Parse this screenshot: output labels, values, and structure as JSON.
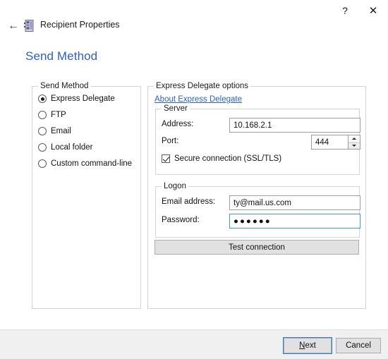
{
  "window": {
    "title": "Recipient Properties",
    "help_label": "?",
    "close_label": "✕",
    "back_label": "←",
    "icon_name": "recipient-properties-icon"
  },
  "page": {
    "heading": "Send Method",
    "heading_color": "#2f5fbe"
  },
  "send_method_group": {
    "legend": "Send Method",
    "options": [
      {
        "label": "Express Delegate",
        "selected": true
      },
      {
        "label": "FTP",
        "selected": false
      },
      {
        "label": "Email",
        "selected": false
      },
      {
        "label": "Local folder",
        "selected": false
      },
      {
        "label": "Custom command-line",
        "selected": false
      }
    ]
  },
  "express_group": {
    "legend": "Express Delegate options",
    "about_link": "About Express Delegate",
    "link_color": "#2b5fc4"
  },
  "server_group": {
    "legend": "Server",
    "address_label": "Address:",
    "address_value": "10.168.2.1",
    "port_label": "Port:",
    "port_value": "444",
    "spin_up": "▲",
    "spin_down": "▼",
    "secure_label": "Secure connection (SSL/TLS)",
    "secure_checked": true
  },
  "logon_group": {
    "legend": "Logon",
    "email_label": "Email address:",
    "email_value": "ty@mail.us.com",
    "password_label": "Password:",
    "password_value": "●●●●●●"
  },
  "actions": {
    "test_connection": "Test connection",
    "next_accel": "N",
    "next_rest": "ext",
    "cancel": "Cancel"
  }
}
